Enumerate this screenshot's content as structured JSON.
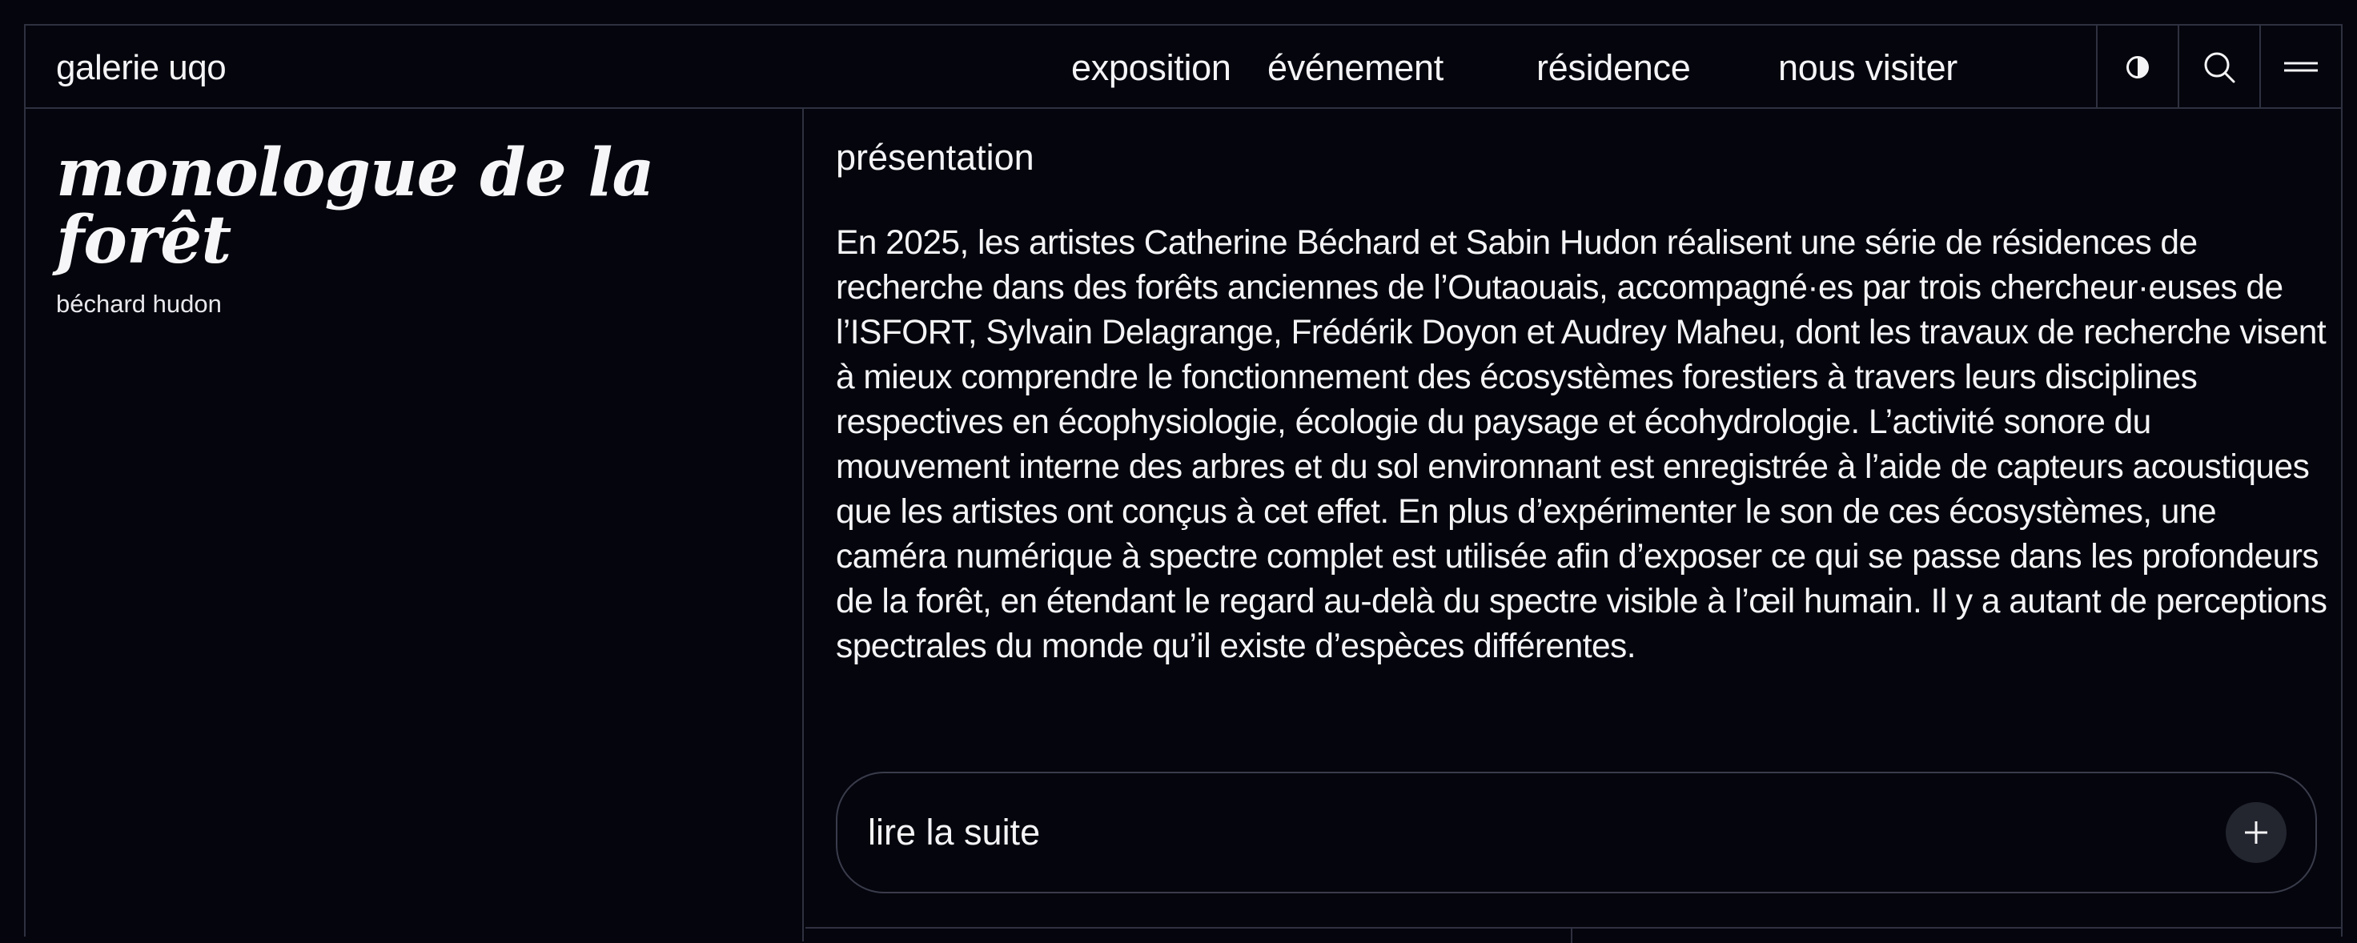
{
  "header": {
    "brand": "galerie uqo",
    "nav": [
      "exposition",
      "événement",
      "résidence",
      "nous visiter"
    ],
    "tools": [
      {
        "name": "contrast-icon"
      },
      {
        "name": "search-icon"
      },
      {
        "name": "menu-icon"
      }
    ]
  },
  "exhibit": {
    "title": "monologue de la forêt",
    "artists": "béchard hudon"
  },
  "presentation": {
    "heading": "présentation",
    "paragraph": "En 2025, les artistes Catherine Béchard et Sabin Hudon réalisent une série de résidences de recherche dans des forêts anciennes de l’Outaouais, accompagné·es par trois chercheur·euses de l’ISFORT, Sylvain Delagrange, Frédérik Doyon et Audrey Maheu, dont les travaux de recherche visent à mieux comprendre le fonctionnement des écosystèmes forestiers à travers leurs disciplines respectives en écophysiologie, écologie du paysage et écohydrologie.  L’activité sonore du mouvement interne des arbres et du sol environnant est enregistrée à l’aide de capteurs acoustiques que les artistes ont conçus à cet effet. En plus d’expérimenter le son de ces écosystèmes, une caméra numérique à spectre complet est utilisée afin d’exposer ce qui se passe dans les profondeurs de la forêt, en étendant le regard au-delà du spectre visible à l’œil humain. Il y a autant de perceptions spectrales du monde qu’il existe d’espèces différentes.",
    "read_more_label": "lire la suite",
    "read_more_icon": "plus-icon"
  },
  "colors": {
    "background": "#04050d",
    "text": "#f4f4f6",
    "border": "#2f3140",
    "button_bg": "#23252f"
  }
}
